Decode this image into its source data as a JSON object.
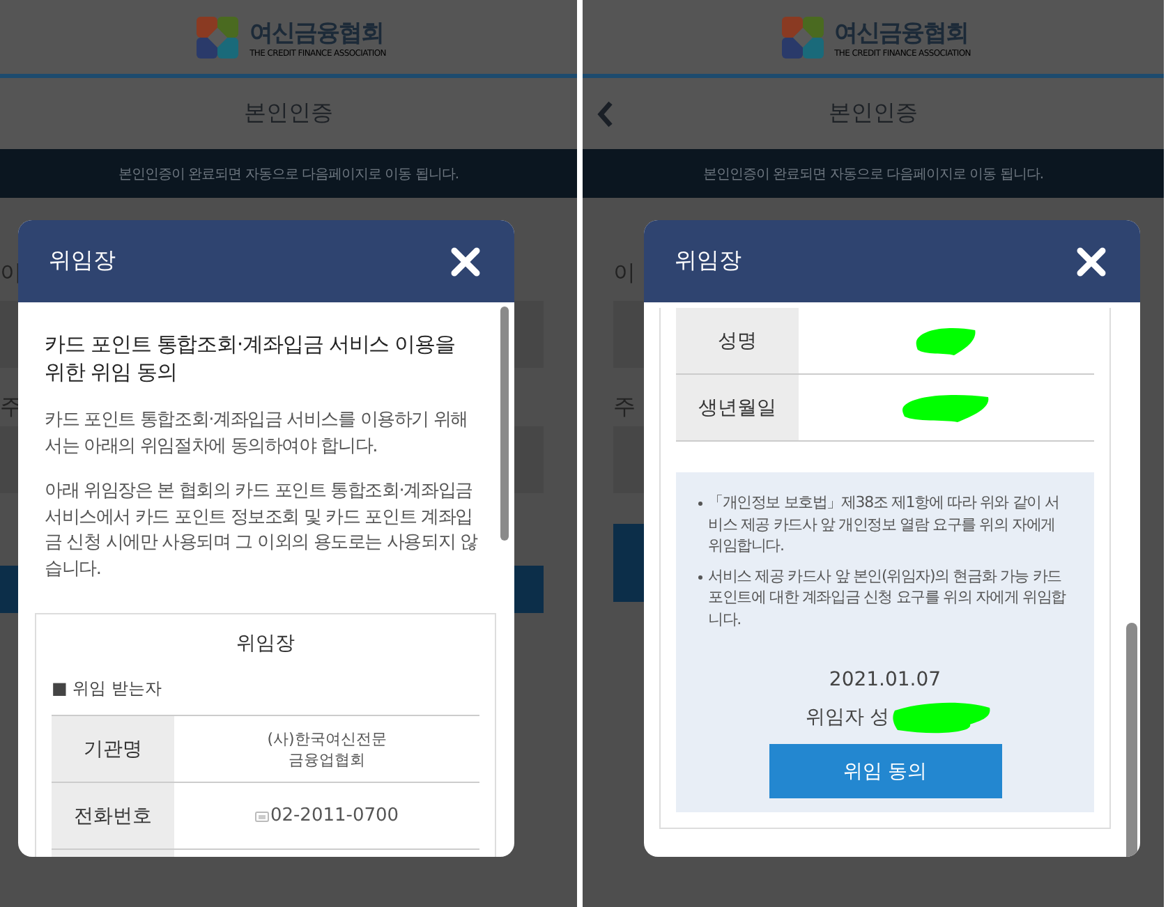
{
  "screens": [
    {
      "logo": {
        "name": "여신금융협회",
        "subtitle": "THE CREDIT FINANCE ASSOCIATION"
      },
      "back_button": false,
      "title": "본인인증",
      "banner": "본인인증이 완료되면 자동으로 다음페이지로 이동 됩니다.",
      "form_labels": [
        "이",
        "주"
      ],
      "modal": {
        "title": "위임장",
        "body": [
          {
            "kind": "heading",
            "text": "카드 포인트 통합조회·계좌입금 서비스 이용을 위한 위임 동의"
          },
          {
            "kind": "paragraph",
            "text": "카드 포인트 통합조회·계좌입금 서비스를 이용하기 위해서는 아래의 위임절차에 동의하여야 합니다."
          },
          {
            "kind": "paragraph",
            "text": "아래 위임장은 본 협회의 카드 포인트 통합조회·계좌입금 서비스에서 카드 포인트 정보조회 및 카드 포인트 계좌입금 신청 시에만 사용되며 그 이외의 용도로는 사용되지 않습니다."
          },
          {
            "kind": "letter",
            "title": "위임장",
            "section": "■ 위임 받는자",
            "rows": [
              {
                "label": "기관명",
                "kind": "text",
                "value": "(사)한국여신전문\n금융업협회"
              },
              {
                "label": "전화번호",
                "kind": "phone",
                "value": "02-2011-0700"
              },
              {
                "kind": "empty"
              }
            ]
          }
        ]
      }
    },
    {
      "logo": {
        "name": "여신금융협회",
        "subtitle": "THE CREDIT FINANCE ASSOCIATION"
      },
      "back_button": true,
      "title": "본인인증",
      "banner": "본인인증이 완료되면 자동으로 다음페이지로 이동 됩니다.",
      "form_labels": [
        "이",
        "주"
      ],
      "modal": {
        "title": "위임장",
        "body": [
          {
            "kind": "letter",
            "rows": [
              {
                "label": "성명",
                "kind": "redacted"
              },
              {
                "label": "생년월일",
                "kind": "redacted"
              }
            ],
            "notice": [
              "「개인정보 보호법」제38조 제1항에 따라 위와 같이 서비스 제공 카드사 앞 개인정보 열람 요구를 위의 자에게 위임합니다.",
              "서비스 제공 카드사 앞 본인(위임자)의 현금화 가능 카드 포인트에 대한 계좌입금 신청 요구를 위의 자에게 위임합니다."
            ],
            "date": "2021.01.07",
            "signer": "위임자 성",
            "signer_redacted": true,
            "button": "위임 동의"
          }
        ]
      }
    }
  ]
}
